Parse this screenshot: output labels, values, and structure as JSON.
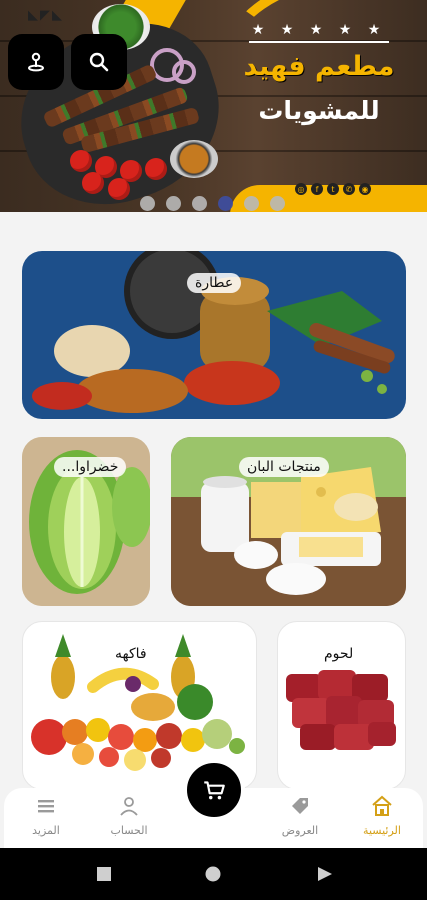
{
  "banner": {
    "title": "مطعم فهيد",
    "subtitle": "للمشويات",
    "stars": "★ ★ ★ ★ ★",
    "slide_count": 6,
    "active_slide": 3
  },
  "header_buttons": {
    "location_icon": "location-pin-icon",
    "search_icon": "search-icon"
  },
  "categories": [
    {
      "id": "spices",
      "label": "عطارة"
    },
    {
      "id": "dairy",
      "label": "منتجات البان"
    },
    {
      "id": "vegetables",
      "label": "خضراوا..."
    },
    {
      "id": "fruits",
      "label": "فاكهه"
    },
    {
      "id": "meat",
      "label": "لحوم"
    }
  ],
  "bottom_nav": {
    "home": "الرئيسية",
    "offers": "العروض",
    "account": "الحساب",
    "more": "المزيد"
  },
  "colors": {
    "accent": "#d4a017",
    "banner_yellow": "#f5b400",
    "dark": "#000000",
    "active_dot": "#3d4ea3"
  }
}
